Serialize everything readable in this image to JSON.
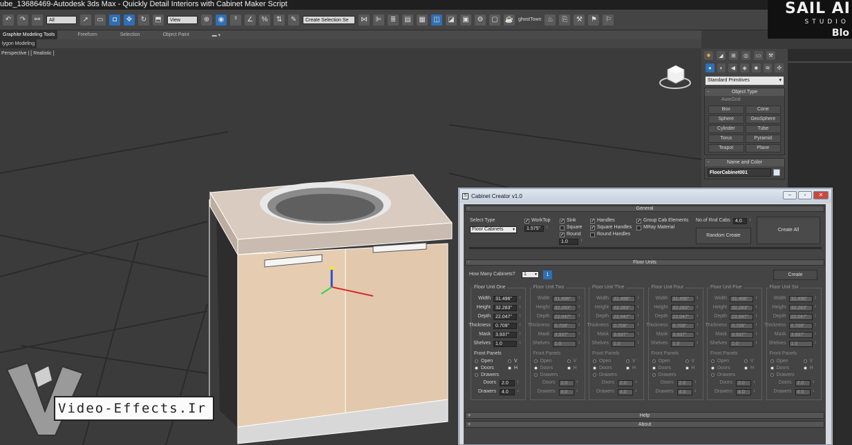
{
  "window_title": "ube_13686469-Autodesk 3ds Max - Quickly Detail Interiors with Cabinet Maker Script",
  "toolbar": {
    "selection_filter": "All",
    "ref_coord": "View",
    "named_selection": "Create Selection Se",
    "user_label": "ghostTown",
    "icons": [
      "undo-icon",
      "redo-icon",
      "link-icon",
      "select-icon",
      "rect-select-icon",
      "move-icon",
      "rotate-icon",
      "snap-icon",
      "mirror-icon",
      "align-icon",
      "layer-icon",
      "curve-editor-icon",
      "schematic-icon",
      "material-icon",
      "render-setup-icon",
      "render-icon"
    ]
  },
  "ribbon": {
    "tabs": [
      "Graphite Modeling Tools",
      "Freeform",
      "Selection",
      "Object Paint"
    ],
    "sub_tab": "lygon Modeling"
  },
  "viewport": {
    "label": "Perspective | [ Realistic ]"
  },
  "brand": {
    "name": "SAIL AI",
    "studio": "STUDIO",
    "blo": "Blo"
  },
  "command_panel": {
    "category": "Standard Primitives",
    "object_type_title": "Object Type",
    "autogrid": "AutoGrid",
    "buttons": [
      "Box",
      "Cone",
      "Sphere",
      "GeoSphere",
      "Cylinder",
      "Tube",
      "Torus",
      "Pyramid",
      "Teapot",
      "Plane"
    ],
    "name_color_title": "Name and Color",
    "object_name": "FloorCabinet001"
  },
  "dialog": {
    "title": "Cabinet Creator v1.0",
    "general": {
      "title": "General",
      "select_type_label": "Select Type",
      "select_type_value": "Floor Cabinets",
      "worktop_label": "WorkTop",
      "worktop_value": "1.575\"",
      "sink_label": "Sink",
      "square_label": "Square",
      "round_label": "Round",
      "round_value": "1.0",
      "handles_label": "Handles",
      "square_handles_label": "Square Handles",
      "round_handles_label": "Round Handles",
      "group_label": "Group Cab Elements",
      "mray_label": "MRay Material",
      "rnd_label": "No.of Rnd Cabs",
      "rnd_value": "4.0",
      "random_create": "Random Create",
      "create_all": "Create All"
    },
    "floor_units": {
      "title": "Floor Units",
      "how_many_label": "How Many Cabinets?",
      "how_many_value": "1",
      "count_badge": "1",
      "create": "Create",
      "field_labels": [
        "Width",
        "Height",
        "Depth",
        "Thickness",
        "Mask",
        "Shelves"
      ],
      "front_panels_label": "Front Panels",
      "radio_open": "Open",
      "radio_doors": "Doors",
      "radio_drawers": "Drawers",
      "radio_v": "V",
      "radio_h": "H",
      "doors_label": "Doors",
      "drawers_label": "Drawers",
      "doors_value": "2.0",
      "drawers_value": "4.0",
      "units": [
        {
          "title": "Floor Unit One",
          "values": [
            "31.496\"",
            "32.283\"",
            "22.047\"",
            "0.709\"",
            "3.937\"",
            "1.0"
          ]
        },
        {
          "title": "Floor Unit Two",
          "values": [
            "31.496\"",
            "32.283\"",
            "22.047\"",
            "0.709\"",
            "3.937\"",
            "1.0"
          ]
        },
        {
          "title": "Floor Unit Thre",
          "values": [
            "31.496\"",
            "32.283\"",
            "22.047\"",
            "0.709\"",
            "3.937\"",
            "1.0"
          ]
        },
        {
          "title": "Floor Unit Four",
          "values": [
            "31.496\"",
            "32.283\"",
            "22.047\"",
            "0.709\"",
            "3.937\"",
            "1.0"
          ]
        },
        {
          "title": "Floor Unit Five",
          "values": [
            "31.496\"",
            "32.283\"",
            "22.047\"",
            "0.709\"",
            "3.937\"",
            "1.0"
          ]
        },
        {
          "title": "Floor Unit Six",
          "values": [
            "31.496\"",
            "32.283\"",
            "22.047\"",
            "0.709\"",
            "3.937\"",
            "1.0"
          ]
        }
      ]
    },
    "help": "Help",
    "about": "About"
  },
  "watermark": {
    "text": "Video-Effects.Ir"
  }
}
